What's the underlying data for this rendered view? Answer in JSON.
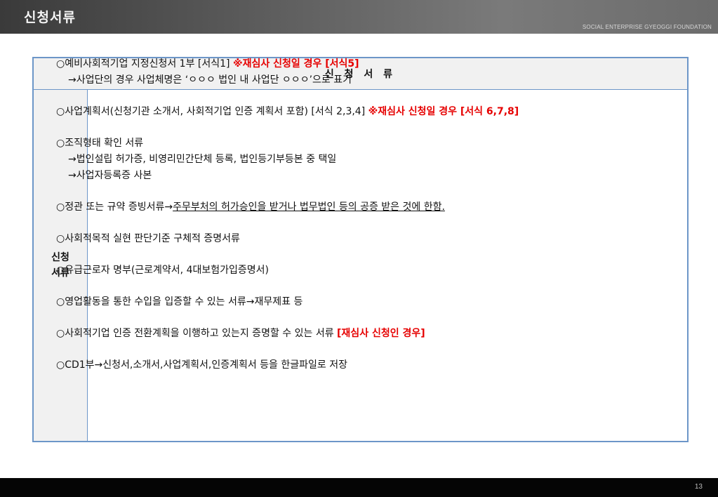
{
  "header": {
    "title": "신청서류",
    "subtitle": "SOCIAL ENTERPRISE GYEOGGI FOUNDATION"
  },
  "table": {
    "heading": "신 청 서 류",
    "row_label_line1": "신청",
    "row_label_line2": "서류",
    "items": [
      {
        "text": "○예비사회적기업 지정신청서 1부 [서식1] ",
        "note": "※재심사 신청일 경우 [서식5]",
        "sub": "→사업단의 경우 사업체명은 ‘ㅇㅇㅇ 법인 내 사업단 ㅇㅇㅇ’으로 표기"
      },
      {
        "text": "○사업계획서(신청기관 소개서, 사회적기업 인증 계획서 포함) [서식 2,3,4] ",
        "note": "※재심사 신청일 경우 [서식 6,7,8]"
      },
      {
        "text": "○조직형태 확인 서류",
        "sub1": "→법인설립 허가증, 비영리민간단체 등록, 법인등기부등본 중 택일",
        "sub2": "→사업자등록증 사본"
      },
      {
        "text": "○정관 또는 규약 증빙서류→",
        "underlined": "주무부처의 허가승인을 받거나 법무법인 등의 공증 받은 것에 한함."
      },
      {
        "text": "○사회적목적 실현 판단기준 구체적 증명서류"
      },
      {
        "text": "○유급근로자 명부(근로계약서, 4대보험가입증명서)"
      },
      {
        "text": "○영업활동을 통한 수입을 입증할 수 있는 서류→재무제표 등"
      },
      {
        "text": "○사회적기업 인증 전환계획을 이행하고 있는지 증명할 수 있는 서류 ",
        "note": "[재심사 신청인 경우]"
      },
      {
        "text": "○CD1부→신청서,소개서,사업계획서,인증계획서 등을 한글파일로 저장"
      }
    ]
  },
  "footer": {
    "page_number": "13"
  },
  "colors": {
    "header_bg": "#5b5b5b",
    "table_border": "#6c96c8",
    "head_bg": "#f1f1f1",
    "highlight_red": "#e60000",
    "footer_bg": "#050505"
  }
}
